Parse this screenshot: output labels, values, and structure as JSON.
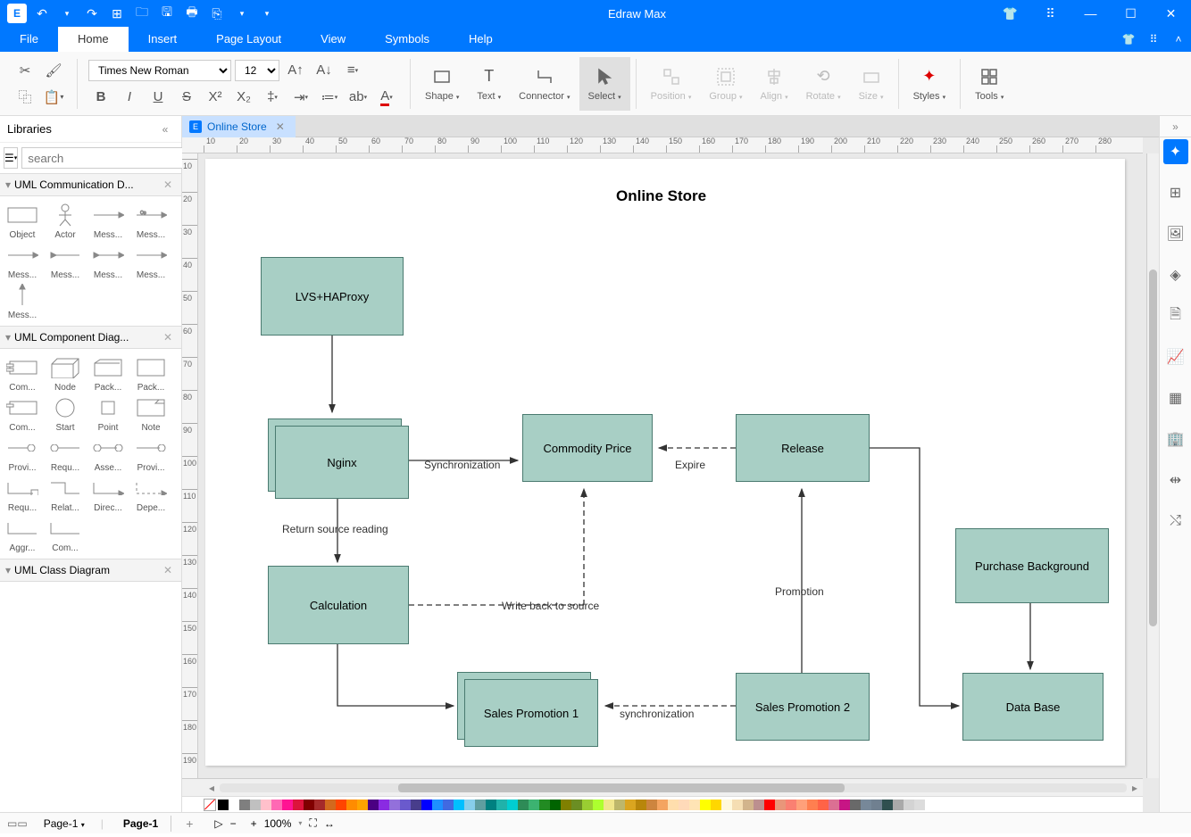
{
  "app": {
    "title": "Edraw Max"
  },
  "menu": {
    "tabs": [
      "File",
      "Home",
      "Insert",
      "Page Layout",
      "View",
      "Symbols",
      "Help"
    ],
    "active": 1
  },
  "ribbon": {
    "font": "Times New Roman",
    "size": "12",
    "tools": {
      "shape": "Shape",
      "text": "Text",
      "connector": "Connector",
      "select": "Select",
      "position": "Position",
      "group": "Group",
      "align": "Align",
      "rotate": "Rotate",
      "size": "Size",
      "styles": "Styles",
      "tools": "Tools"
    }
  },
  "libraries": {
    "title": "Libraries",
    "search_placeholder": "search",
    "cats": [
      {
        "name": "UML Communication D...",
        "shapes": [
          "Object",
          "Actor",
          "Mess...",
          "Mess...",
          "Mess...",
          "Mess...",
          "Mess...",
          "Mess...",
          "Mess..."
        ]
      },
      {
        "name": "UML Component Diag...",
        "shapes": [
          "Com...",
          "Node",
          "Pack...",
          "Pack...",
          "Com...",
          "Start",
          "Point",
          "Note",
          "Provi...",
          "Requ...",
          "Asse...",
          "Provi...",
          "Requ...",
          "Relat...",
          "Direc...",
          "Depe...",
          "Aggr...",
          "Com..."
        ]
      },
      {
        "name": "UML Class Diagram",
        "shapes": []
      }
    ]
  },
  "doc": {
    "tab_label": "Online Store",
    "title": "Online Store",
    "nodes": {
      "lvs": "LVS+HAProxy",
      "nginx": "Nginx",
      "price": "Commodity Price",
      "release": "Release",
      "calc": "Calculation",
      "promo1": "Sales Promotion 1",
      "promo2": "Sales Promotion 2",
      "purchase": "Purchase Background",
      "db": "Data Base"
    },
    "edges": {
      "sync": "Synchronization",
      "expire": "Expire",
      "returnsrc": "Return source reading",
      "writeback": "Write back to source",
      "promotion": "Promotion",
      "sync2": "synchronization"
    }
  },
  "ruler_h": [
    10,
    20,
    30,
    40,
    50,
    60,
    70,
    80,
    90,
    100,
    110,
    120,
    130,
    140,
    150,
    160,
    170,
    180,
    190,
    200,
    210,
    220,
    230,
    240,
    250,
    260,
    270,
    280
  ],
  "ruler_v": [
    10,
    20,
    30,
    40,
    50,
    60,
    70,
    80,
    90,
    100,
    110,
    120,
    130,
    140,
    150,
    160,
    170,
    180,
    190
  ],
  "palette": [
    "#000",
    "#fff",
    "#7f7f7f",
    "#c0c0c0",
    "#ffc0cb",
    "#ff69b4",
    "#ff1493",
    "#dc143c",
    "#800000",
    "#a52a2a",
    "#d2691e",
    "#ff4500",
    "#ff8c00",
    "#ffa500",
    "#4b0082",
    "#8a2be2",
    "#9370db",
    "#6a5acd",
    "#483d8b",
    "#0000ff",
    "#1e90ff",
    "#4169e1",
    "#00bfff",
    "#87ceeb",
    "#5f9ea0",
    "#008080",
    "#20b2aa",
    "#00ced1",
    "#2e8b57",
    "#3cb371",
    "#228b22",
    "#006400",
    "#808000",
    "#6b8e23",
    "#9acd32",
    "#adff2f",
    "#f0e68c",
    "#bdb76b",
    "#daa520",
    "#b8860b",
    "#cd853f",
    "#f4a460",
    "#ffdead",
    "#ffdab9",
    "#ffe4b5",
    "#ffff00",
    "#ffd700",
    "#fff8dc",
    "#f5deb3",
    "#d2b48c",
    "#bc8f8f",
    "#ff0000",
    "#e9967a",
    "#fa8072",
    "#ffa07a",
    "#ff7f50",
    "#ff6347",
    "#db7093",
    "#c71585",
    "#696969",
    "#778899",
    "#708090",
    "#2f4f4f",
    "#a9a9a9",
    "#d3d3d3",
    "#dcdcdc"
  ],
  "pagebar": {
    "selector": "Page-1",
    "current": "Page-1"
  },
  "status": {
    "zoom": "100%"
  },
  "right_tools": [
    "cursor",
    "grid",
    "image",
    "layers",
    "page",
    "chart",
    "table",
    "org",
    "align",
    "shuffle"
  ]
}
